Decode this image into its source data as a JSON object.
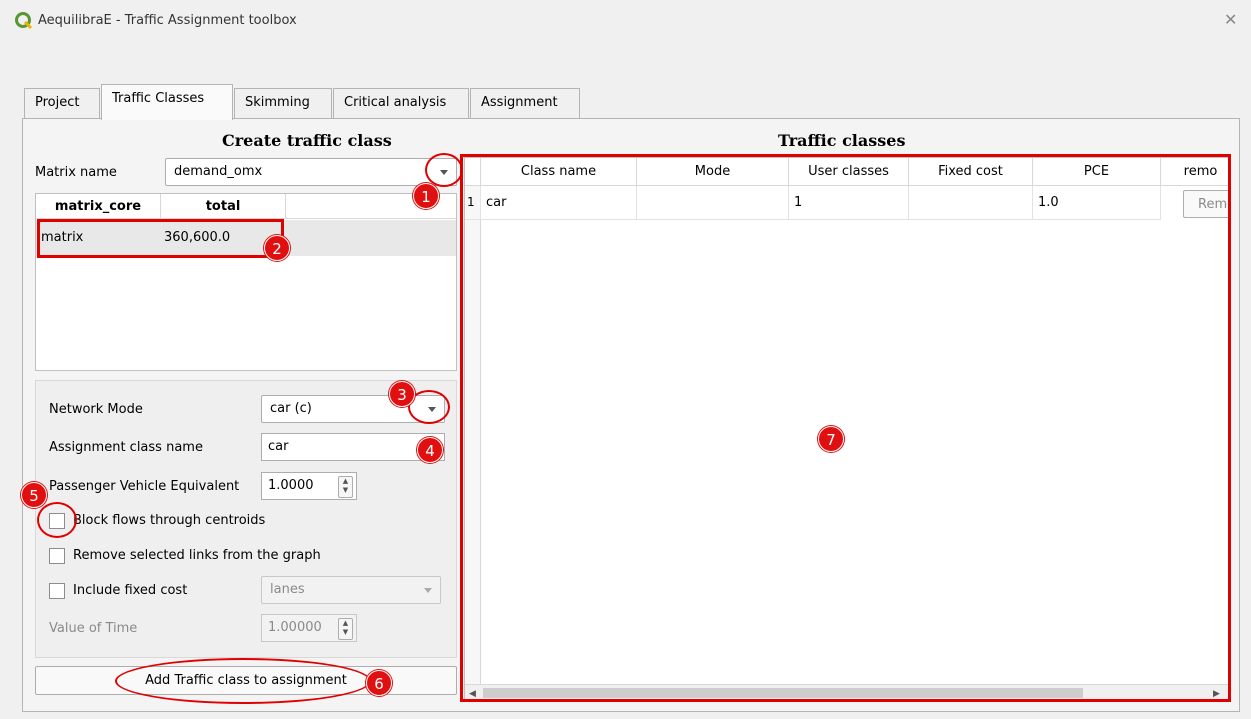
{
  "window": {
    "title": "AequilibraE - Traffic Assignment toolbox",
    "close": "✕"
  },
  "tabs": [
    {
      "label": "Project"
    },
    {
      "label": "Traffic Classes"
    },
    {
      "label": "Skimming"
    },
    {
      "label": "Critical analysis"
    },
    {
      "label": "Assignment"
    }
  ],
  "create": {
    "title": "Create traffic class",
    "matrix_name_label": "Matrix name",
    "matrix_name_value": "demand_omx",
    "core_table": {
      "headers": [
        "matrix_core",
        "total"
      ],
      "rows": [
        [
          "matrix",
          "360,600.0"
        ]
      ]
    },
    "network_mode_label": "Network Mode",
    "network_mode_value": "car (c)",
    "assignment_class_label": "Assignment class name",
    "assignment_class_value": "car",
    "pce_label": "Passenger Vehicle Equivalent",
    "pce_value": "1.0000",
    "block_flows_label": "Block flows through centroids",
    "remove_links_label": "Remove selected links from the graph",
    "fixed_cost_label": "Include fixed cost",
    "fixed_cost_field": "lanes",
    "vot_label": "Value of Time",
    "vot_value": "1.00000",
    "add_button": "Add Traffic class to assignment"
  },
  "classes": {
    "title": "Traffic classes",
    "headers": [
      "Class name",
      "Mode",
      "User classes",
      "Fixed cost",
      "PCE",
      "remo"
    ],
    "rows": [
      {
        "index": "1",
        "class_name": "car",
        "mode": "",
        "user_classes": "1",
        "fixed_cost": "",
        "pce": "1.0",
        "remove": "Remo"
      }
    ]
  },
  "badges": [
    "1",
    "2",
    "3",
    "4",
    "5",
    "6",
    "7"
  ],
  "colors": {
    "annotation_red": "#e00000",
    "qgis_green": "#589632"
  }
}
